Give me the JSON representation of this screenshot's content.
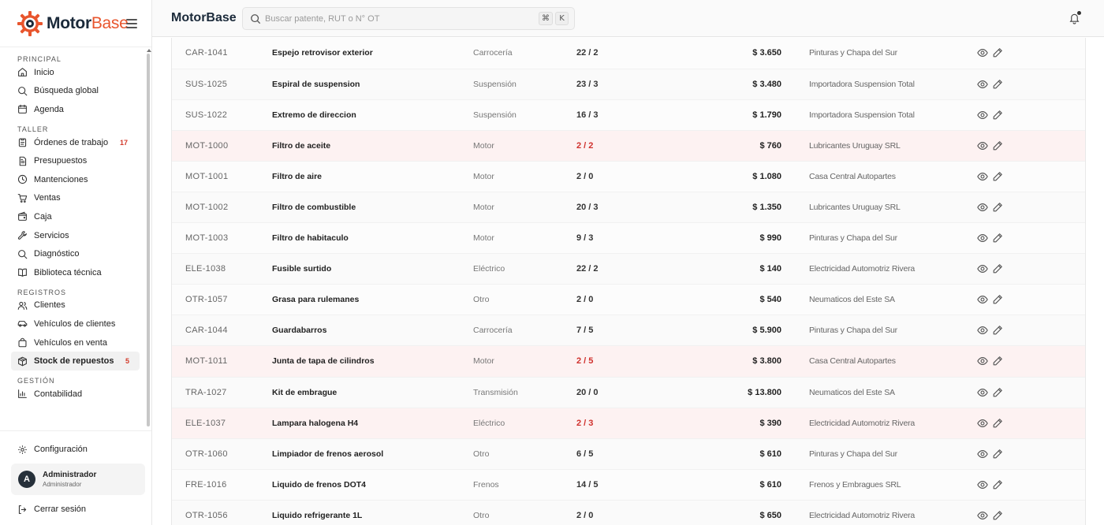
{
  "brand": {
    "name_main": "Motor",
    "name_accent": "Base",
    "gear_color": "#e8552d",
    "dark_color": "#1b2a3a"
  },
  "header": {
    "title": "MotorBase",
    "search_placeholder": "Buscar patente, RUT o N° OT",
    "shortcut_cmd": "⌘",
    "shortcut_key": "K"
  },
  "sidebar": {
    "sections": [
      {
        "title": "PRINCIPAL",
        "items": [
          {
            "label": "Inicio",
            "icon": "home-icon"
          },
          {
            "label": "Búsqueda global",
            "icon": "search-icon"
          },
          {
            "label": "Agenda",
            "icon": "calendar-icon"
          }
        ]
      },
      {
        "title": "TALLER",
        "items": [
          {
            "label": "Órdenes de trabajo",
            "icon": "clipboard-icon",
            "badge": "17"
          },
          {
            "label": "Presupuestos",
            "icon": "document-icon"
          },
          {
            "label": "Mantenciones",
            "icon": "clock-icon"
          },
          {
            "label": "Ventas",
            "icon": "cart-icon"
          },
          {
            "label": "Caja",
            "icon": "wallet-icon"
          },
          {
            "label": "Servicios",
            "icon": "wrench-icon"
          },
          {
            "label": "Diagnóstico",
            "icon": "search-icon"
          },
          {
            "label": "Biblioteca técnica",
            "icon": "book-icon"
          }
        ]
      },
      {
        "title": "REGISTROS",
        "items": [
          {
            "label": "Clientes",
            "icon": "users-icon"
          },
          {
            "label": "Vehículos de clientes",
            "icon": "car-icon"
          },
          {
            "label": "Vehículos en venta",
            "icon": "shopping-bag-icon"
          },
          {
            "label": "Stock de repuestos",
            "icon": "box-icon",
            "badge": "5",
            "active": true
          }
        ]
      },
      {
        "title": "GESTIÓN",
        "items": [
          {
            "label": "Contabilidad",
            "icon": "bar-chart-icon"
          }
        ]
      }
    ],
    "config_label": "Configuración",
    "user": {
      "initial": "A",
      "name": "Administrador",
      "role": "Administrador"
    },
    "logout_label": "Cerrar sesión"
  },
  "colors": {
    "alert": "#d0312d",
    "low_stock_row": "#fdf2f2"
  },
  "table": {
    "rows": [
      {
        "code": "CAR-1041",
        "name": "Espejo retrovisor exterior",
        "category": "Carrocería",
        "stock": "22 / 2",
        "price": "$ 3.650",
        "supplier": "Pinturas y Chapa del Sur",
        "low": false
      },
      {
        "code": "SUS-1025",
        "name": "Espiral de suspension",
        "category": "Suspensión",
        "stock": "23 / 3",
        "price": "$ 3.480",
        "supplier": "Importadora Suspension Total",
        "low": false
      },
      {
        "code": "SUS-1022",
        "name": "Extremo de direccion",
        "category": "Suspensión",
        "stock": "16 / 3",
        "price": "$ 1.790",
        "supplier": "Importadora Suspension Total",
        "low": false
      },
      {
        "code": "MOT-1000",
        "name": "Filtro de aceite",
        "category": "Motor",
        "stock": "2 / 2",
        "price": "$ 760",
        "supplier": "Lubricantes Uruguay SRL",
        "low": true
      },
      {
        "code": "MOT-1001",
        "name": "Filtro de aire",
        "category": "Motor",
        "stock": "2 / 0",
        "price": "$ 1.080",
        "supplier": "Casa Central Autopartes",
        "low": false
      },
      {
        "code": "MOT-1002",
        "name": "Filtro de combustible",
        "category": "Motor",
        "stock": "20 / 3",
        "price": "$ 1.350",
        "supplier": "Lubricantes Uruguay SRL",
        "low": false
      },
      {
        "code": "MOT-1003",
        "name": "Filtro de habitaculo",
        "category": "Motor",
        "stock": "9 / 3",
        "price": "$ 990",
        "supplier": "Pinturas y Chapa del Sur",
        "low": false
      },
      {
        "code": "ELE-1038",
        "name": "Fusible surtido",
        "category": "Eléctrico",
        "stock": "22 / 2",
        "price": "$ 140",
        "supplier": "Electricidad Automotriz Rivera",
        "low": false
      },
      {
        "code": "OTR-1057",
        "name": "Grasa para rulemanes",
        "category": "Otro",
        "stock": "2 / 0",
        "price": "$ 540",
        "supplier": "Neumaticos del Este SA",
        "low": false
      },
      {
        "code": "CAR-1044",
        "name": "Guardabarros",
        "category": "Carrocería",
        "stock": "7 / 5",
        "price": "$ 5.900",
        "supplier": "Pinturas y Chapa del Sur",
        "low": false
      },
      {
        "code": "MOT-1011",
        "name": "Junta de tapa de cilindros",
        "category": "Motor",
        "stock": "2 / 5",
        "price": "$ 3.800",
        "supplier": "Casa Central Autopartes",
        "low": true
      },
      {
        "code": "TRA-1027",
        "name": "Kit de embrague",
        "category": "Transmisión",
        "stock": "20 / 0",
        "price": "$ 13.800",
        "supplier": "Neumaticos del Este SA",
        "low": false
      },
      {
        "code": "ELE-1037",
        "name": "Lampara halogena H4",
        "category": "Eléctrico",
        "stock": "2 / 3",
        "price": "$ 390",
        "supplier": "Electricidad Automotriz Rivera",
        "low": true
      },
      {
        "code": "OTR-1060",
        "name": "Limpiador de frenos aerosol",
        "category": "Otro",
        "stock": "6 / 5",
        "price": "$ 610",
        "supplier": "Pinturas y Chapa del Sur",
        "low": false
      },
      {
        "code": "FRE-1016",
        "name": "Liquido de frenos DOT4",
        "category": "Frenos",
        "stock": "14 / 5",
        "price": "$ 610",
        "supplier": "Frenos y Embragues SRL",
        "low": false
      },
      {
        "code": "OTR-1056",
        "name": "Liquido refrigerante 1L",
        "category": "Otro",
        "stock": "2 / 0",
        "price": "$ 650",
        "supplier": "Electricidad Automotriz Rivera",
        "low": false
      }
    ]
  }
}
